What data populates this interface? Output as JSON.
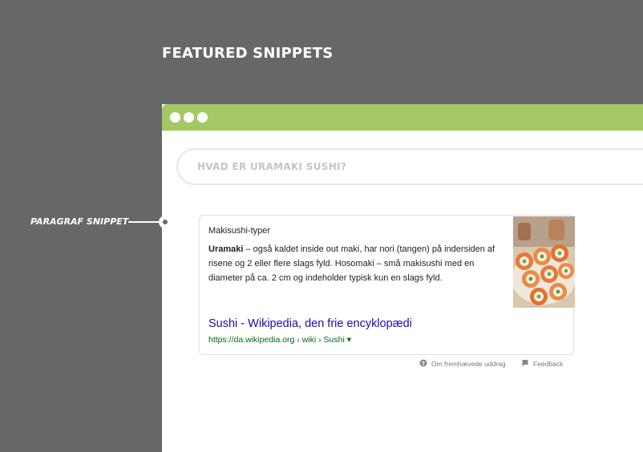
{
  "page": {
    "title": "FEATURED SNIPPETS"
  },
  "browser": {
    "search": {
      "query": "HVAD ER URAMAKI SUSHI?"
    }
  },
  "annotation": {
    "label": "PARAGRAF SNIPPET"
  },
  "snippet": {
    "heading": "Makisushi-typer",
    "bold_term": "Uramaki",
    "text": " – også kaldet inside out maki, har nori (tangen) på indersiden af risene og 2 eller flere slags fyld. Hosomaki – små makisushi med en diameter på ca. 2 cm og indeholder typisk kun en slags fyld.",
    "link_title": "Sushi - Wikipedia, den frie encyklopædi",
    "url": "https://da.wikipedia.org › wiki › Sushi",
    "url_dropdown": "▾"
  },
  "footer": {
    "about_label": "Om fremhævede uddrag",
    "feedback_label": "Feedback"
  },
  "colors": {
    "background": "#676767",
    "titlebar": "#a4c866",
    "link": "#1a0dab",
    "url": "#006621"
  }
}
